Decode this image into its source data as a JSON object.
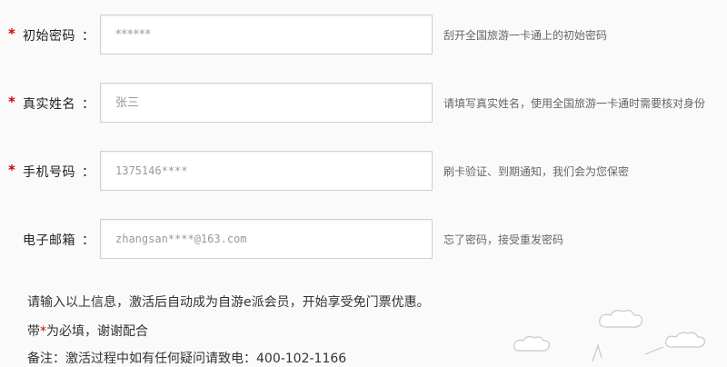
{
  "form": {
    "required_mark": "*",
    "colon": "：",
    "fields": [
      {
        "label": "初始密码",
        "placeholder": "******",
        "hint": "刮开全国旅游一卡通上的初始密码",
        "required": true
      },
      {
        "label": "真实姓名",
        "placeholder": "张三",
        "hint": "请填写真实姓名，使用全国旅游一卡通时需要核对身份",
        "required": true
      },
      {
        "label": "手机号码",
        "placeholder": "1375146****",
        "hint": "刷卡验证、到期通知，我们会为您保密",
        "required": true
      },
      {
        "label": "电子邮箱",
        "placeholder": "zhangsan****@163.com",
        "hint": "忘了密码，接受重发密码",
        "required": false
      }
    ]
  },
  "notes": {
    "line1": "请输入以上信息，激活后自动成为自游e派会员，开始享受免门票优惠。",
    "line2_prefix": "带",
    "line2_star": "*",
    "line2_suffix": "为必填，谢谢配合",
    "line3": "备注：激活过程中如有任何疑问请致电：400-102-1166"
  },
  "colors": {
    "required": "#d40000",
    "input_border": "#cfcfcf",
    "background": "#fafafa"
  }
}
